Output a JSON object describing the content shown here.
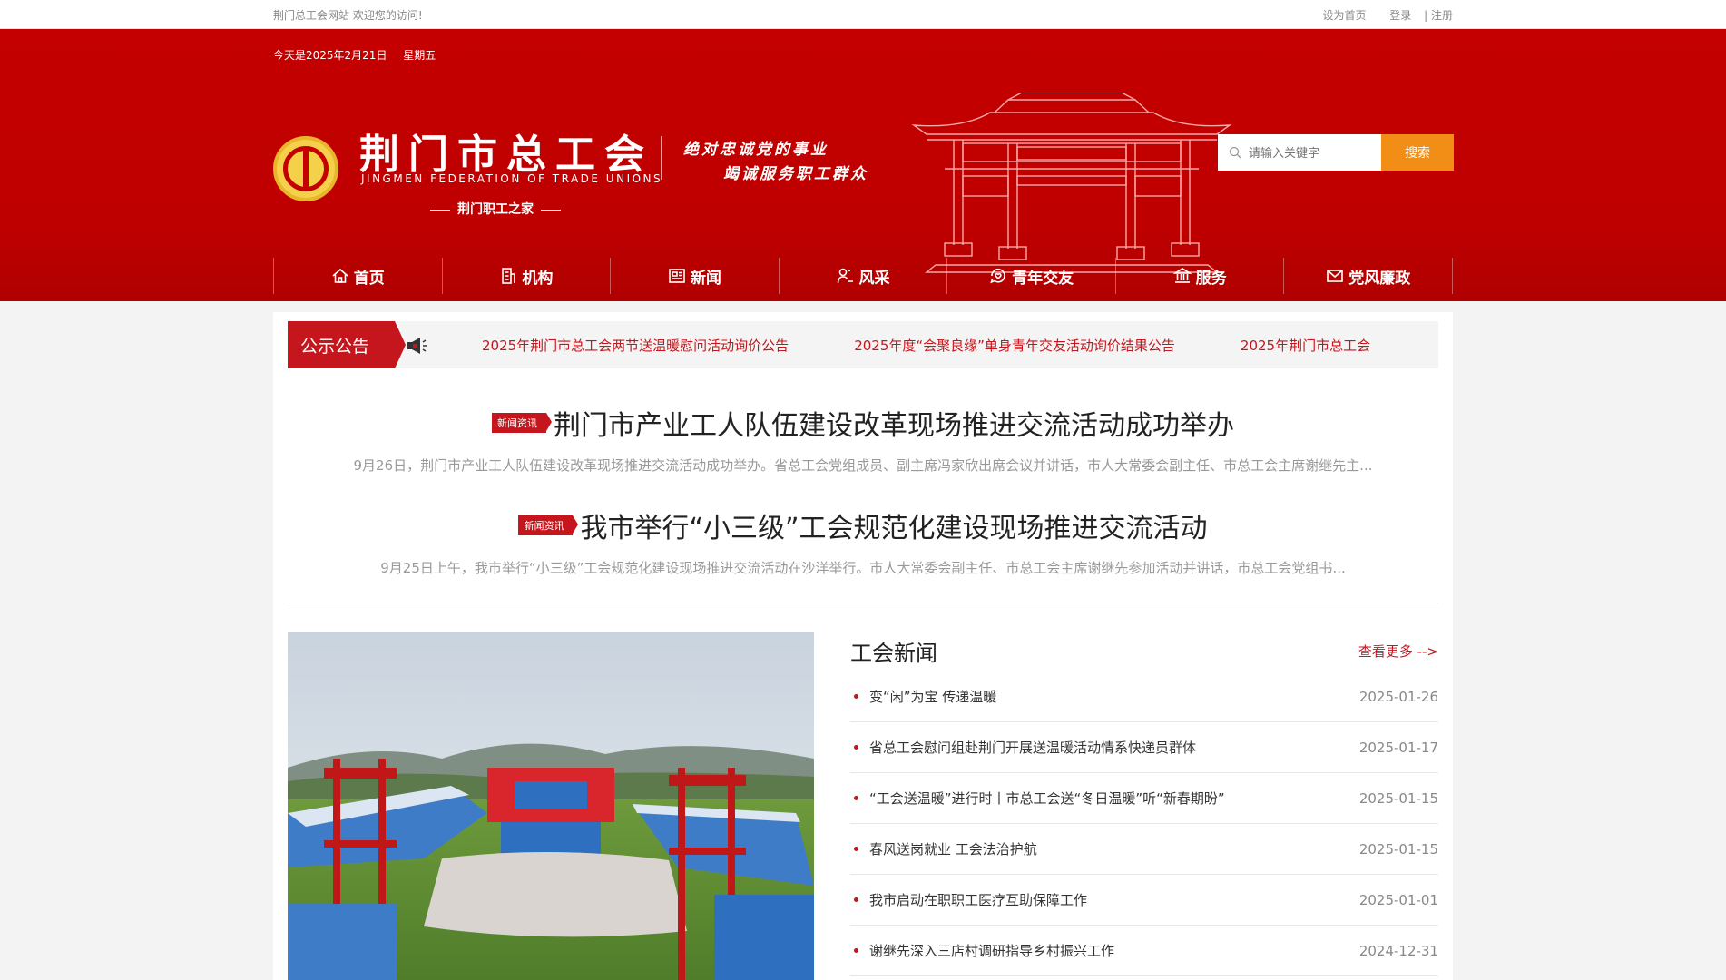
{
  "topbar": {
    "welcome": "荆门总工会网站 欢迎您的访问!",
    "set_home": "设为首页",
    "login": "登录",
    "register": "| 注册"
  },
  "header": {
    "date": "今天是2025年2月21日",
    "weekday": "星期五",
    "title": "荆门市总工会",
    "title_en": "JINGMEN FEDERATION OF TRADE UNIONS",
    "subtitle": "荆门职工之家",
    "slogan_line1": "绝对忠诚党的事业",
    "slogan_line2": "竭诚服务职工群众"
  },
  "search": {
    "placeholder": "请输入关键字",
    "button": "搜索"
  },
  "nav": {
    "home": "首页",
    "org": "机构",
    "news": "新闻",
    "style": "风采",
    "youth": "青年交友",
    "service": "服务",
    "party": "党风廉政"
  },
  "notice": {
    "tag": "公示公告",
    "items": [
      "2025年荆门市总工会两节送温暖慰问活动询价公告",
      "2025年度“会聚良缘”单身青年交友活动询价结果公告",
      "2025年荆门市总工会"
    ]
  },
  "headlines": [
    {
      "badge": "新闻资讯",
      "title": "荆门市产业工人队伍建设改革现场推进交流活动成功举办",
      "desc": "9月26日，荆门市产业工人队伍建设改革现场推进交流活动成功举办。省总工会党组成员、副主席冯家欣出席会议并讲话，市人大常委会副主任、市总工会主席谢继先主..."
    },
    {
      "badge": "新闻资讯",
      "title": "我市举行“小三级”工会规范化建设现场推进交流活动",
      "desc": "9月25日上午，我市举行“小三级”工会规范化建设现场推进交流活动在沙洋举行。市人大常委会副主任、市总工会主席谢继先参加活动并讲话，市总工会党组书..."
    }
  ],
  "union_news": {
    "title": "工会新闻",
    "more": "查看更多 -->",
    "items": [
      {
        "title": "变“闲”为宝 传递温暖",
        "date": "2025-01-26"
      },
      {
        "title": "省总工会慰问组赴荆门开展送温暖活动情系快递员群体",
        "date": "2025-01-17"
      },
      {
        "title": "“工会送温暖”进行时丨市总工会送“冬日温暖”听“新春期盼”",
        "date": "2025-01-15"
      },
      {
        "title": "春风送岗就业 工会法治护航",
        "date": "2025-01-15"
      },
      {
        "title": "我市启动在职职工医疗互助保障工作",
        "date": "2025-01-01"
      },
      {
        "title": "谢继先深入三店村调研指导乡村振兴工作",
        "date": "2024-12-31"
      }
    ]
  }
}
